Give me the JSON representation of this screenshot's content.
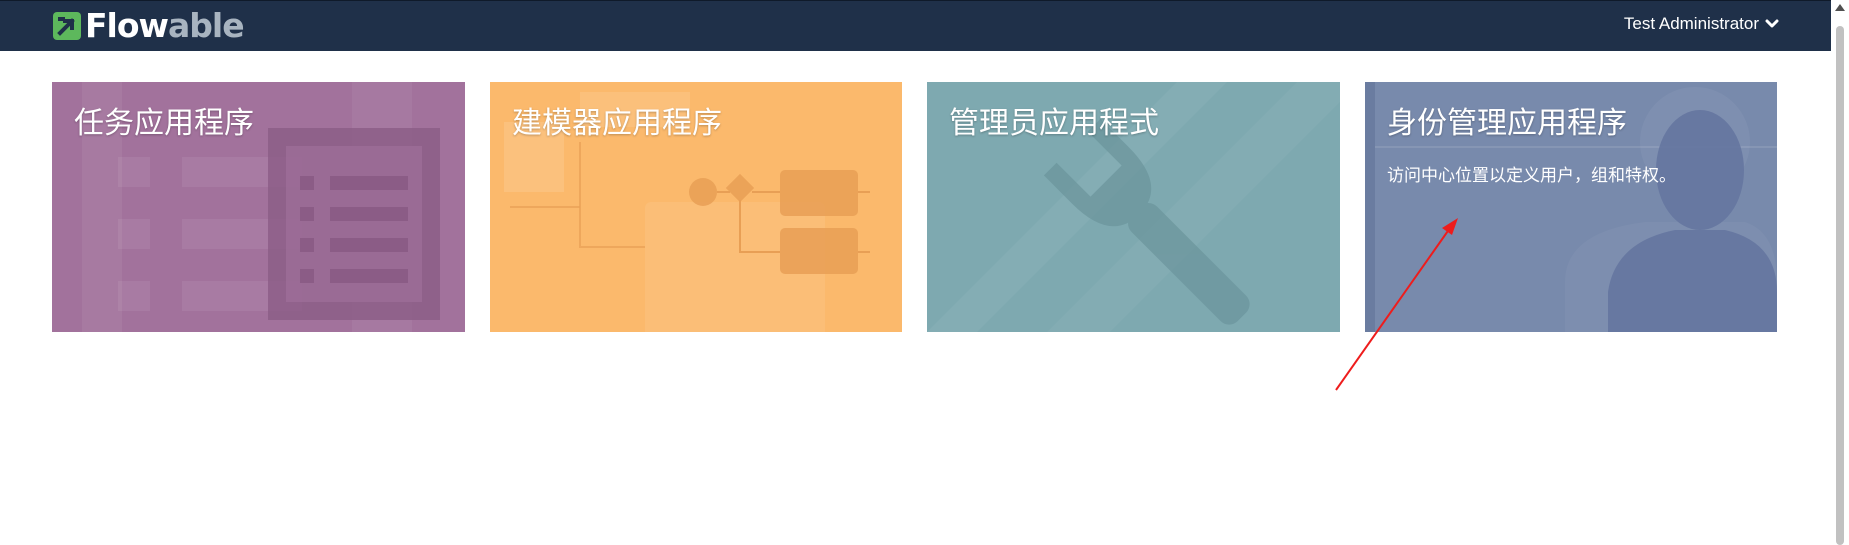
{
  "header": {
    "logo_flo": "Flow",
    "logo_able": "able",
    "user_label": "Test Administrator"
  },
  "tiles": [
    {
      "title": "任务应用程序",
      "description": "",
      "color": "#a2729c",
      "icon": "task-list-icon"
    },
    {
      "title": "建模器应用程序",
      "description": "",
      "color": "#fbb96c",
      "icon": "process-diagram-icon"
    },
    {
      "title": "管理员应用程式",
      "description": "",
      "color": "#7ea9b0",
      "icon": "wrench-icon"
    },
    {
      "title": "身份管理应用程序",
      "description": "访问中心位置以定义用户，组和特权。",
      "color": "#788aac",
      "icon": "user-silhouette-icon"
    }
  ],
  "colors": {
    "topbar": "#1f3049",
    "logo_green": "#5db85c",
    "annotation_arrow": "#ee1c1c"
  }
}
